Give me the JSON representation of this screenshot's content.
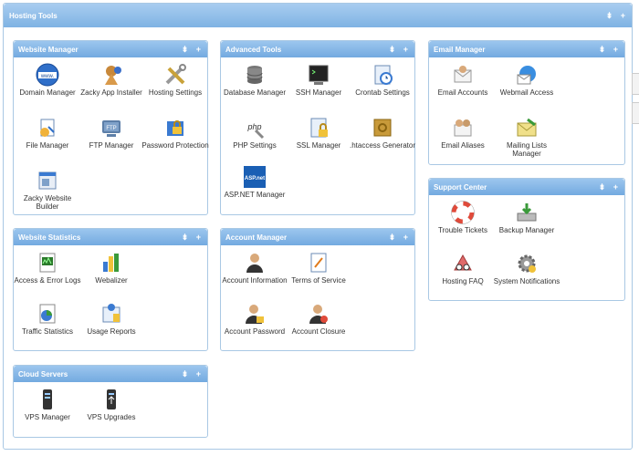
{
  "header": {
    "title": "Hosting Tools",
    "controls": "⇟ +"
  },
  "panels": {
    "website_manager": {
      "title": "Website Manager",
      "items": [
        "Domain Manager",
        "Zacky App Installer",
        "Hosting Settings",
        "File Manager",
        "FTP Manager",
        "Password Protection",
        "Zacky Website Builder"
      ]
    },
    "advanced_tools": {
      "title": "Advanced Tools",
      "items": [
        "Database Manager",
        "SSH Manager",
        "Crontab Settings",
        "PHP Settings",
        "SSL Manager",
        ".htaccess Generator",
        "ASP.NET Manager"
      ]
    },
    "email_manager": {
      "title": "Email Manager",
      "items": [
        "Email Accounts",
        "Webmail Access",
        "Email Aliases",
        "Mailing Lists Manager"
      ]
    },
    "support_center": {
      "title": "Support Center",
      "items": [
        "Trouble Tickets",
        "Backup Manager",
        "Hosting FAQ",
        "System Notifications"
      ]
    },
    "website_statistics": {
      "title": "Website Statistics",
      "items": [
        "Access & Error Logs",
        "Webalizer",
        "Traffic Statistics",
        "Usage Reports"
      ]
    },
    "account_manager": {
      "title": "Account Manager",
      "items": [
        "Account Information",
        "Terms of Service",
        "Account Password",
        "Account Closure"
      ]
    },
    "cloud_servers": {
      "title": "Cloud Servers",
      "items": [
        "VPS Manager",
        "VPS Upgrades"
      ]
    }
  },
  "icon_glyphs": {
    "www": "www.",
    "ftp": "FTP",
    "php": "php",
    "asp": "ASP.net"
  },
  "colors": {
    "header_top": "#a8cdf0",
    "header_bottom": "#73aae0",
    "border": "#a9c8e4"
  }
}
